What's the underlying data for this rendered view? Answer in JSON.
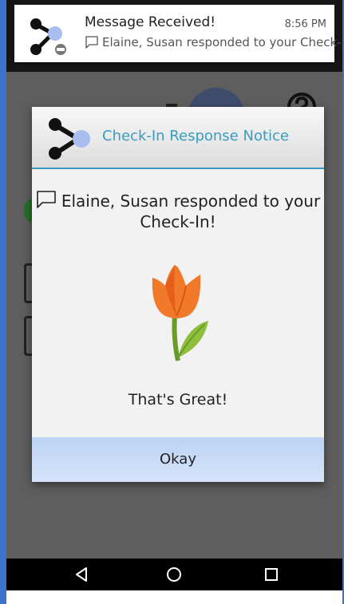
{
  "notification": {
    "title": "Message Received!",
    "time": "8:56 PM",
    "body": "Elaine, Susan responded to your Check-.."
  },
  "dialog": {
    "header_title": "Check-In Response Notice",
    "message": "Elaine, Susan responded to your Check-In!",
    "response_text": "That's Great!",
    "response_icon": "tulip",
    "okay_label": "Okay"
  },
  "navigation": {
    "back": "back-icon",
    "home": "home-icon",
    "recents": "recents-icon"
  },
  "colors": {
    "accent": "#3a9cc0",
    "okay_button": "#c9dcf7",
    "frame": "#3d73c6"
  }
}
